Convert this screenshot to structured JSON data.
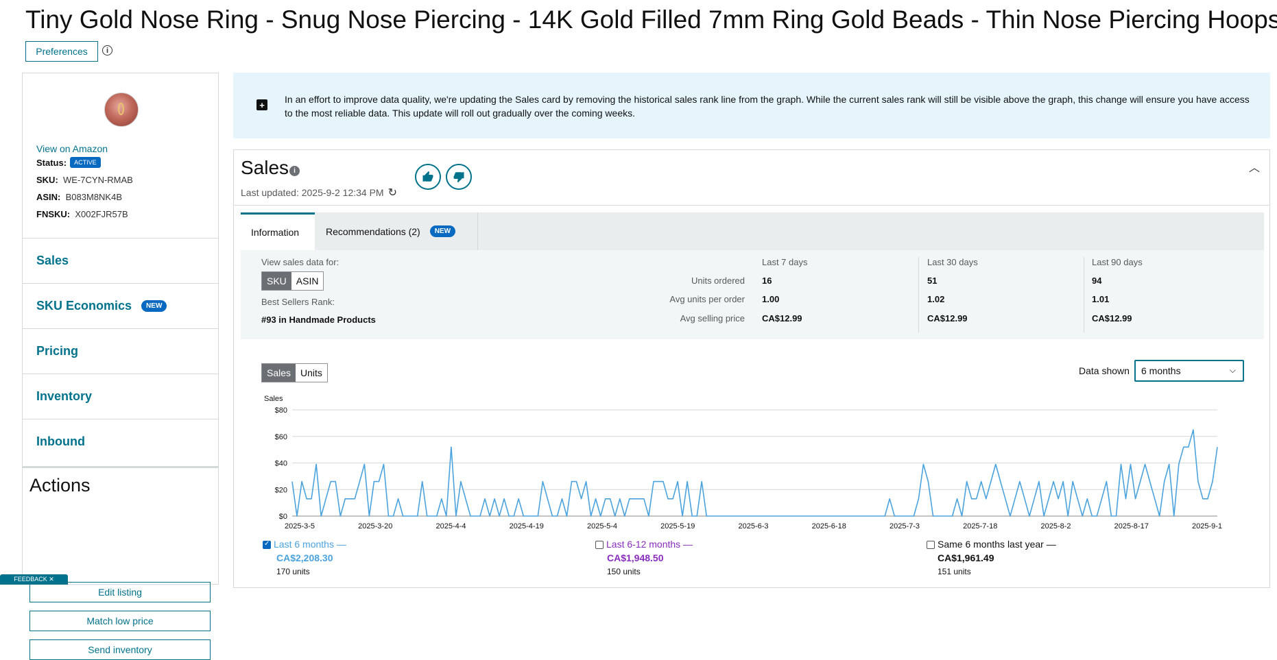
{
  "product_title": "Tiny Gold Nose Ring - Snug Nose Piercing - 14K Gold Filled 7mm Ring Gold Beads - Thin Nose Piercing Hoops",
  "preferences_label": "Preferences",
  "info_icon_glyph": "i",
  "sidebar": {
    "view_on_amazon": "View on Amazon",
    "status_label": "Status:",
    "status_value": "ACTIVE",
    "sku_label": "SKU:",
    "sku_value": "WE-7CYN-RMAB",
    "asin_label": "ASIN:",
    "asin_value": "B083M8NK4B",
    "fnsku_label": "FNSKU:",
    "fnsku_value": "X002FJR57B",
    "nav": [
      {
        "label": "Sales"
      },
      {
        "label": "SKU Economics",
        "badge": "NEW"
      },
      {
        "label": "Pricing"
      },
      {
        "label": "Inventory"
      },
      {
        "label": "Inbound"
      }
    ],
    "actions_title": "Actions",
    "actions": [
      "Edit listing",
      "Match low price",
      "Send inventory"
    ],
    "feedback": "FEEDBACK ✕"
  },
  "notice": {
    "text": "In an effort to improve data quality, we're updating the Sales card by removing the historical sales rank line from the graph. While the current sales rank will still be visible above the graph, this change will ensure you have access to the most reliable data. This update will roll out gradually over the coming weeks."
  },
  "sales_card": {
    "title": "Sales",
    "last_updated": "Last updated: 2025-9-2 12:34 PM",
    "tabs": {
      "information": "Information",
      "recommendations": "Recommendations (2)",
      "recommendations_badge": "NEW"
    },
    "view_sales_label": "View sales data for:",
    "view_toggle": {
      "sku": "SKU",
      "asin": "ASIN",
      "selected": "SKU"
    },
    "bsr_label": "Best Sellers Rank:",
    "bsr_value": "#93 in Handmade Products",
    "columns": [
      "Last 7 days",
      "Last 30 days",
      "Last 90 days"
    ],
    "rows": [
      {
        "label": "Units ordered",
        "values": [
          "16",
          "51",
          "94"
        ]
      },
      {
        "label": "Avg units per order",
        "values": [
          "1.00",
          "1.02",
          "1.01"
        ]
      },
      {
        "label": "Avg selling price",
        "values": [
          "CA$12.99",
          "CA$12.99",
          "CA$12.99"
        ]
      }
    ],
    "chart_toggle": {
      "sales": "Sales",
      "units": "Units",
      "selected": "Sales"
    },
    "data_shown_label": "Data shown",
    "data_shown_value": "6 months",
    "legend": [
      {
        "label": "Last 6 months",
        "amount": "CA$2,208.30",
        "units": "170 units",
        "checked": true,
        "color": "#4aa3df"
      },
      {
        "label": "Last 6-12 months",
        "amount": "CA$1,948.50",
        "units": "150 units",
        "checked": false,
        "color": "#8a2cbf"
      },
      {
        "label": "Same 6 months last year",
        "amount": "CA$1,961.49",
        "units": "151 units",
        "checked": false,
        "color": "#0f1111"
      }
    ]
  },
  "colors": {
    "accent": "#00728c",
    "badge_blue": "#0769c0",
    "series_line": "#4aa3df",
    "notice_bg": "#e6f4fb"
  },
  "chart_data": {
    "type": "line",
    "ylabel": "Sales",
    "ylim": [
      0,
      80
    ],
    "yticks": [
      "$0",
      "$20",
      "$40",
      "$60",
      "$80"
    ],
    "xtick_labels": [
      "2025-3-5",
      "2025-3-20",
      "2025-4-4",
      "2025-4-19",
      "2025-5-4",
      "2025-5-19",
      "2025-6-3",
      "2025-6-18",
      "2025-7-3",
      "2025-7-18",
      "2025-8-2",
      "2025-8-17",
      "2025-9-1"
    ],
    "grid": true,
    "series": [
      {
        "name": "Last 6 months",
        "values": [
          26,
          0,
          26,
          13,
          13,
          39,
          0,
          13,
          26,
          26,
          0,
          13,
          13,
          13,
          26,
          39,
          0,
          26,
          26,
          39,
          0,
          0,
          13,
          0,
          0,
          0,
          0,
          26,
          0,
          0,
          0,
          13,
          0,
          52,
          0,
          26,
          13,
          0,
          0,
          0,
          13,
          0,
          13,
          0,
          13,
          0,
          0,
          13,
          0,
          0,
          0,
          0,
          26,
          13,
          0,
          0,
          13,
          0,
          26,
          26,
          13,
          26,
          0,
          13,
          0,
          13,
          13,
          0,
          13,
          0,
          13,
          13,
          13,
          13,
          0,
          26,
          26,
          26,
          13,
          13,
          26,
          0,
          26,
          0,
          0,
          26,
          0,
          0,
          0,
          0,
          0,
          0,
          0,
          0,
          0,
          0,
          0,
          0,
          0,
          0,
          0,
          0,
          0,
          0,
          0,
          0,
          0,
          0,
          0,
          0,
          0,
          0,
          0,
          0,
          0,
          0,
          0,
          0,
          0,
          0,
          0,
          0,
          0,
          0,
          13,
          0,
          0,
          0,
          0,
          0,
          13,
          39,
          26,
          0,
          0,
          0,
          0,
          0,
          13,
          0,
          26,
          13,
          13,
          26,
          13,
          26,
          39,
          26,
          13,
          0,
          13,
          26,
          13,
          0,
          13,
          26,
          0,
          13,
          26,
          13,
          26,
          0,
          26,
          13,
          0,
          13,
          0,
          0,
          13,
          26,
          0,
          0,
          39,
          13,
          39,
          13,
          26,
          39,
          26,
          13,
          0,
          26,
          39,
          0,
          39,
          52,
          52,
          65,
          26,
          13,
          13,
          26,
          52
        ]
      }
    ]
  }
}
